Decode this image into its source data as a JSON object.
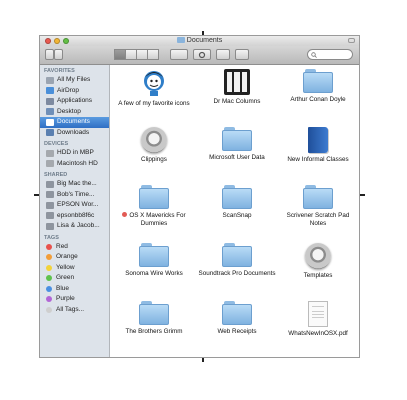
{
  "window": {
    "title": "Documents"
  },
  "sidebar": {
    "favorites_header": "FAVORITES",
    "favorites": [
      {
        "label": "All My Files",
        "icon": "all-files-icon"
      },
      {
        "label": "AirDrop",
        "icon": "airdrop-icon"
      },
      {
        "label": "Applications",
        "icon": "applications-icon"
      },
      {
        "label": "Desktop",
        "icon": "desktop-icon"
      },
      {
        "label": "Documents",
        "icon": "documents-icon",
        "selected": true
      },
      {
        "label": "Downloads",
        "icon": "downloads-icon"
      }
    ],
    "devices_header": "DEVICES",
    "devices": [
      {
        "label": "HDD in MBP",
        "icon": "disk-icon"
      },
      {
        "label": "Macintosh HD",
        "icon": "disk-icon"
      }
    ],
    "shared_header": "SHARED",
    "shared": [
      {
        "label": "Big Mac the...",
        "icon": "computer-icon"
      },
      {
        "label": "Bob's Time...",
        "icon": "computer-icon"
      },
      {
        "label": "EPSON Wor...",
        "icon": "computer-icon"
      },
      {
        "label": "epsonbb8f6c",
        "icon": "computer-icon"
      },
      {
        "label": "Lisa & Jacob...",
        "icon": "computer-icon"
      }
    ],
    "tags_header": "TAGS",
    "tags": [
      {
        "label": "Red",
        "color": "#e8524d"
      },
      {
        "label": "Orange",
        "color": "#f29d38"
      },
      {
        "label": "Yellow",
        "color": "#f2d33a"
      },
      {
        "label": "Green",
        "color": "#5fc24d"
      },
      {
        "label": "Blue",
        "color": "#4a90e2"
      },
      {
        "label": "Purple",
        "color": "#b266d6"
      },
      {
        "label": "All Tags...",
        "color": "#cfcfcf"
      }
    ]
  },
  "files": [
    {
      "name": "A few of my favorite icons",
      "type": "icon-file"
    },
    {
      "name": "Dr Mac Columns",
      "type": "columns-file"
    },
    {
      "name": "Arthur Conan Doyle",
      "type": "folder"
    },
    {
      "name": "Clippings",
      "type": "disk"
    },
    {
      "name": "Microsoft User Data",
      "type": "folder"
    },
    {
      "name": "New Informal Classes",
      "type": "book"
    },
    {
      "name": "OS X Mavericks For Dummies",
      "type": "folder",
      "tag_color": "#e25b55"
    },
    {
      "name": "ScanSnap",
      "type": "folder"
    },
    {
      "name": "Scrivener Scratch Pad Notes",
      "type": "folder"
    },
    {
      "name": "Sonoma Wire Works",
      "type": "folder"
    },
    {
      "name": "Soundtrack Pro Documents",
      "type": "folder"
    },
    {
      "name": "Templates",
      "type": "disk"
    },
    {
      "name": "The Brothers Grimm",
      "type": "folder"
    },
    {
      "name": "Web Receipts",
      "type": "folder"
    },
    {
      "name": "WhatsNewInOSX.pdf",
      "type": "document"
    }
  ]
}
